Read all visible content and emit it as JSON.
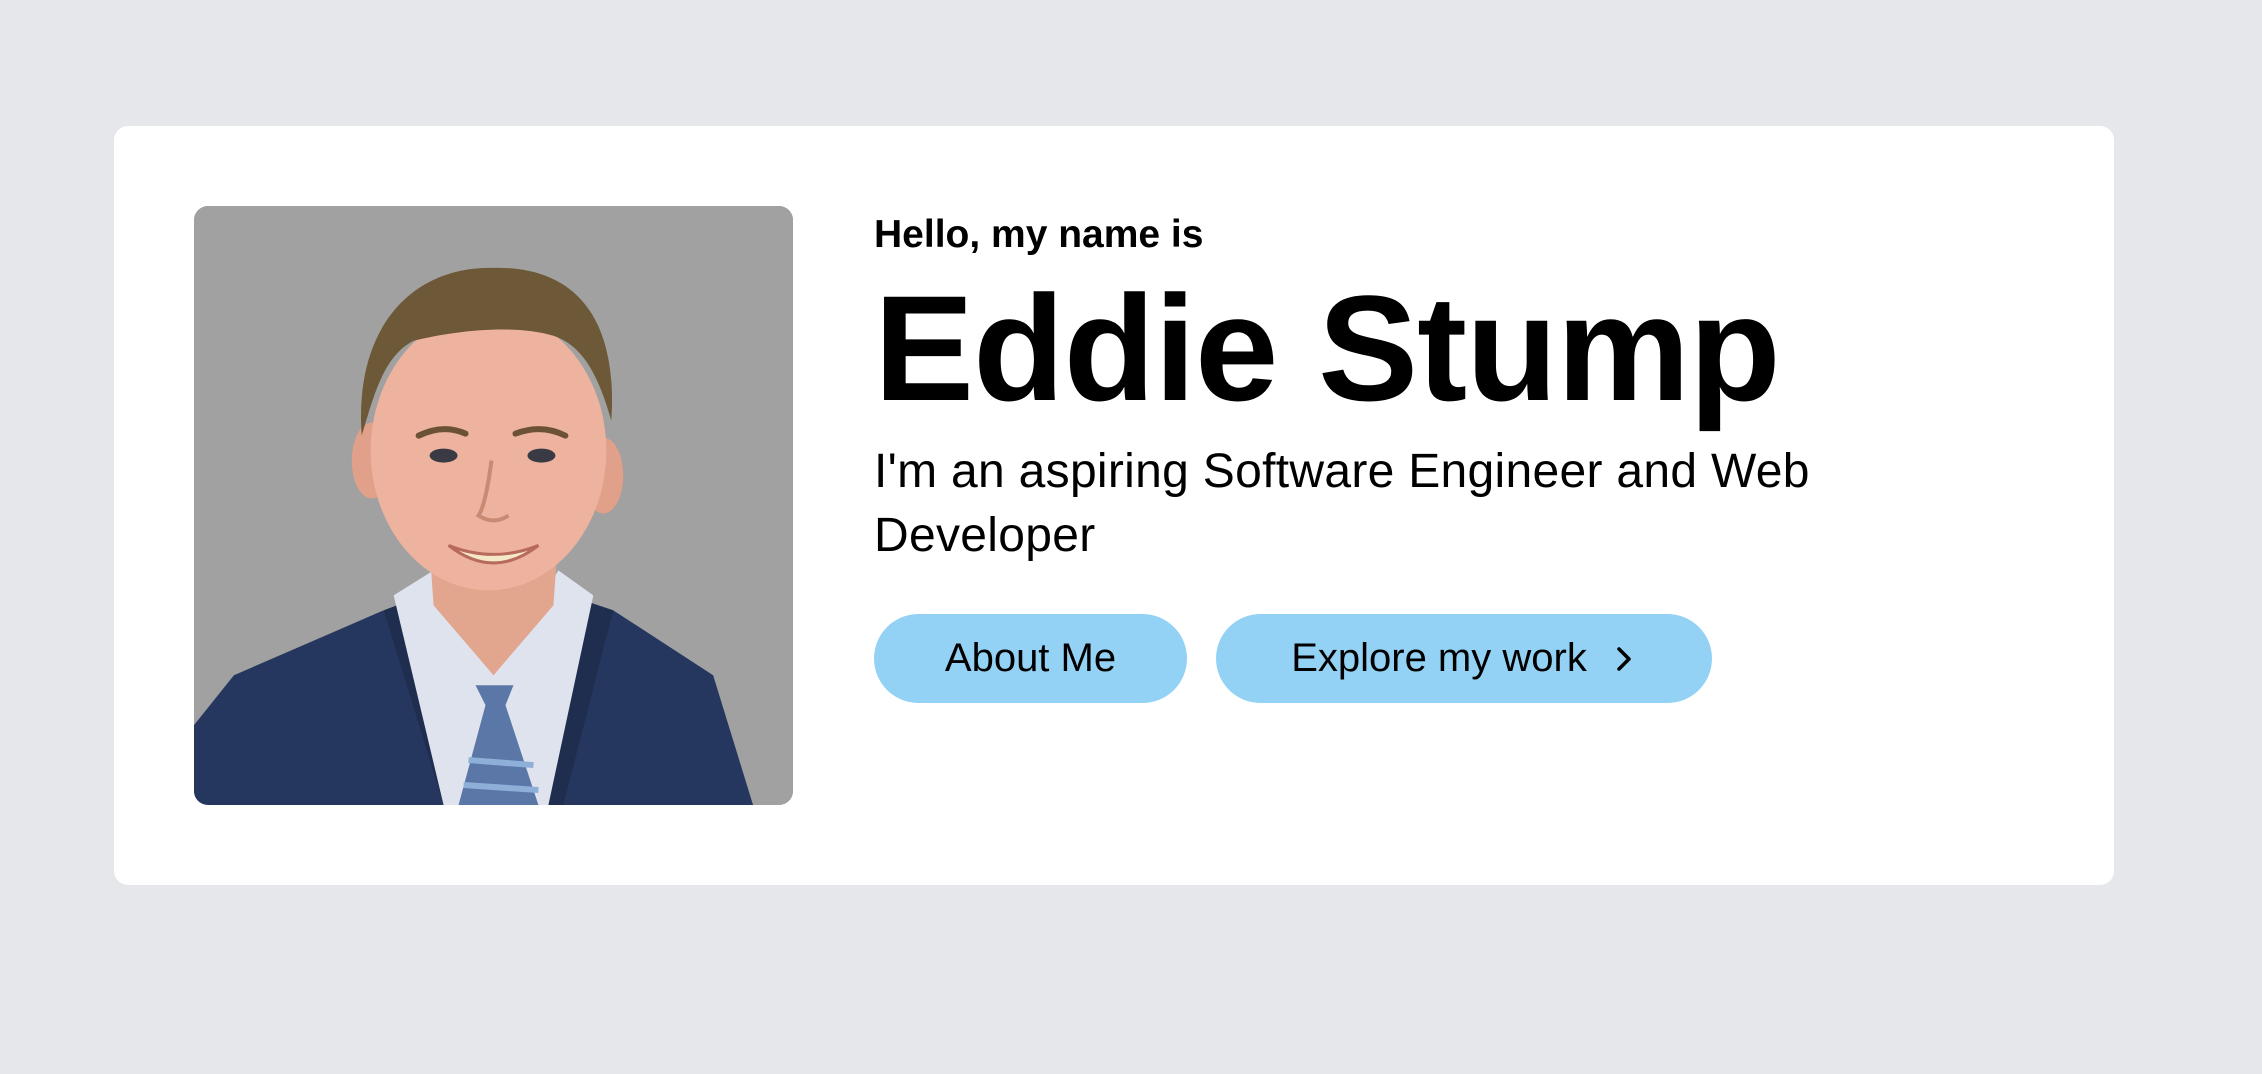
{
  "hero": {
    "greeting": "Hello, my name is",
    "name": "Eddie Stump",
    "tagline": "I'm an aspiring Software Engineer and Web Developer",
    "photo_alt": "Portrait photo of Eddie Stump"
  },
  "buttons": {
    "about_label": "About Me",
    "explore_label": "Explore my work",
    "explore_icon": "chevron-right-icon"
  },
  "colors": {
    "page_background": "#e5e7eb",
    "card_background": "#ffffff",
    "button_background": "#93d2f5",
    "photo_background": "#a1a1a1"
  }
}
